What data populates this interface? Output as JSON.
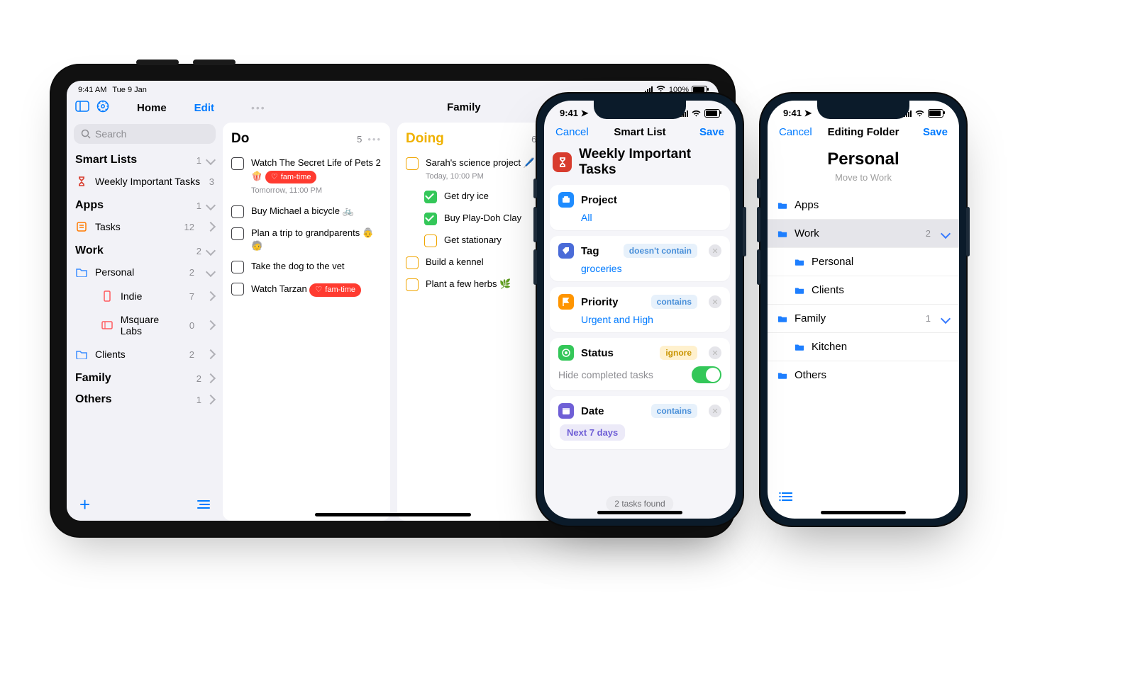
{
  "ipad": {
    "status": {
      "time": "9:41 AM",
      "date": "Tue 9 Jan",
      "battery": "100%"
    },
    "sidebar": {
      "home": "Home",
      "edit": "Edit",
      "search_placeholder": "Search",
      "smartlists": {
        "label": "Smart Lists",
        "count": "1"
      },
      "smartlist_item": {
        "label": "Weekly Important Tasks",
        "count": "3"
      },
      "apps": {
        "label": "Apps",
        "count": "1"
      },
      "apps_item": {
        "label": "Tasks",
        "count": "12"
      },
      "work": {
        "label": "Work",
        "count": "2"
      },
      "work_personal": {
        "label": "Personal",
        "count": "2"
      },
      "work_indie": {
        "label": "Indie",
        "count": "7"
      },
      "work_msquare": {
        "label": "Msquare Labs",
        "count": "0"
      },
      "work_clients": {
        "label": "Clients",
        "count": "2"
      },
      "family": {
        "label": "Family",
        "count": "2"
      },
      "others": {
        "label": "Others",
        "count": "1"
      }
    },
    "board": {
      "title": "Family",
      "col_do": {
        "title": "Do",
        "count": "5",
        "t1": "Watch The Secret Life of Pets 2 🍿",
        "t1_tag": "fam-time",
        "t1_meta": "Tomorrow, 11:00 PM",
        "t2": "Buy Michael a bicycle 🚲",
        "t3": "Plan a trip to grandparents 👵 🧓",
        "t4": "Take the dog to the vet",
        "t5": "Watch Tarzan",
        "t5_tag": "fam-time"
      },
      "col_doing": {
        "title": "Doing",
        "count": "6",
        "title_color": "#efb100",
        "t1": "Sarah's science project 🖊️",
        "t1_meta": "Today, 10:00 PM",
        "s1": "Get dry ice",
        "s2": "Buy Play-Doh Clay",
        "s3": "Get stationary",
        "t2": "Build a kennel",
        "t3": "Plant a few herbs 🌿"
      }
    }
  },
  "phone_a": {
    "status_time": "9:41",
    "nav": {
      "cancel": "Cancel",
      "title": "Smart List",
      "save": "Save"
    },
    "heading": "Weekly Important Tasks",
    "cards": {
      "project": {
        "label": "Project",
        "value": "All",
        "icon_bg": "#1e8cff"
      },
      "tag": {
        "label": "Tag",
        "chip": "doesn't contain",
        "chip_bg": "#e7f1fb",
        "chip_fg": "#4a90d9",
        "value": "groceries",
        "icon_bg": "#4a6bd8"
      },
      "priority": {
        "label": "Priority",
        "chip": "contains",
        "chip_bg": "#e7f1fb",
        "chip_fg": "#4a90d9",
        "value": "Urgent and High",
        "icon_bg": "#ff9500"
      },
      "status": {
        "label": "Status",
        "chip": "ignore",
        "chip_bg": "#fff1ce",
        "chip_fg": "#c99400",
        "hide": "Hide completed tasks",
        "icon_bg": "#34c759"
      },
      "date": {
        "label": "Date",
        "chip": "contains",
        "chip_bg": "#e7f1fb",
        "chip_fg": "#4a90d9",
        "valchip": "Next 7 days",
        "icon_bg": "#6f5fd6"
      }
    },
    "footer": "2 tasks found"
  },
  "phone_b": {
    "status_time": "9:41",
    "nav": {
      "cancel": "Cancel",
      "title": "Editing Folder",
      "save": "Save"
    },
    "heading": "Personal",
    "move_hint": "Move to Work",
    "items": {
      "apps": "Apps",
      "work": "Work",
      "work_ct": "2",
      "personal": "Personal",
      "clients": "Clients",
      "family": "Family",
      "family_ct": "1",
      "kitchen": "Kitchen",
      "others": "Others"
    }
  }
}
